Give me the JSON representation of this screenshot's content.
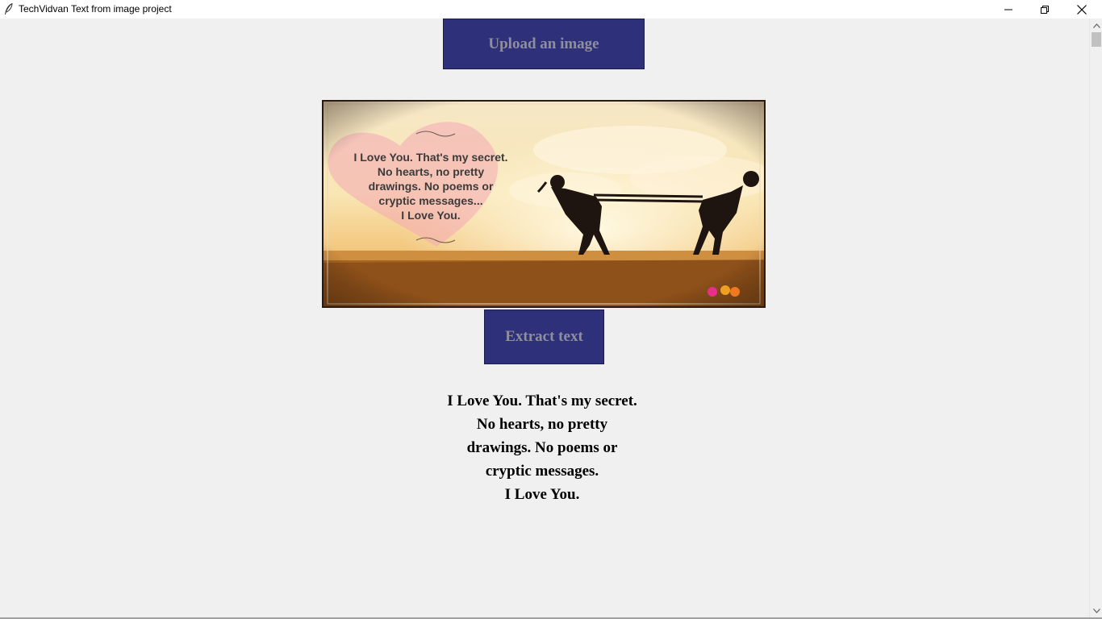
{
  "window": {
    "title": "TechVidvan Text from image project",
    "icon": "feather-icon",
    "controls": [
      "minimize-icon",
      "restore-icon",
      "close-icon"
    ]
  },
  "upload_button": {
    "label": "Upload an image"
  },
  "preview_image": {
    "overlay_text": [
      "I Love You. That's my secret.",
      "No hearts, no pretty",
      "drawings. No poems or",
      "cryptic messages...",
      "I Love You."
    ]
  },
  "extract_button": {
    "label": "Extract text"
  },
  "extracted_text": {
    "lines": [
      "I Love You. That's my secret.",
      "No hearts, no pretty",
      "drawings. No poems or",
      "cryptic messages.",
      "I Love You."
    ]
  },
  "colors": {
    "button_bg": "#2e307a",
    "button_text": "#8f8f9c",
    "window_bg": "#f0f0f0"
  }
}
